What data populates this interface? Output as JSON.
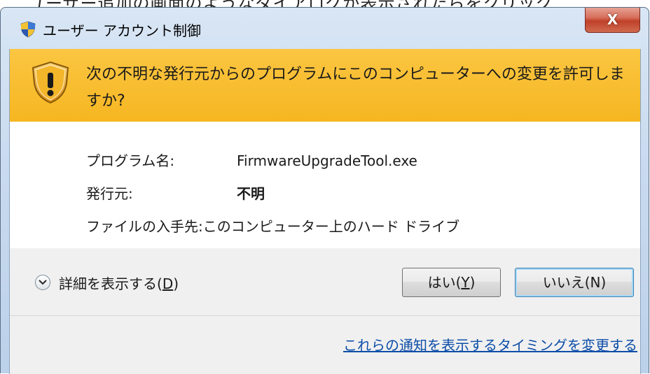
{
  "background_text": "ユーザー追加の画面のようなダイアログが表示されたらをクリック",
  "window": {
    "title": "ユーザー アカウント制御",
    "close_label": "X"
  },
  "banner": {
    "message": "次の不明な発行元からのプログラムにこのコンピューターへの変更を許可しますか?"
  },
  "details": {
    "program_name_label": "プログラム名:",
    "program_name_value": "FirmwareUpgradeTool.exe",
    "publisher_label": "発行元:",
    "publisher_value": "不明",
    "origin_label": "ファイルの入手先:",
    "origin_value": "このコンピューター上のハード ドライブ"
  },
  "actions": {
    "show_details_text": "詳細を表示する(",
    "show_details_key": "D",
    "show_details_close": ")",
    "yes_text": "はい(",
    "yes_key": "Y",
    "yes_close": ")",
    "no_text": "いいえ(N)",
    "notify_link": "これらの通知を表示するタイミングを変更する"
  },
  "colors": {
    "banner": "#f6b621",
    "link": "#0d4ea8",
    "close_button": "#c0412a"
  },
  "icons": {
    "title": "uac-shield-icon",
    "banner": "warning-shield-icon",
    "toggle": "chevron-down-icon"
  }
}
